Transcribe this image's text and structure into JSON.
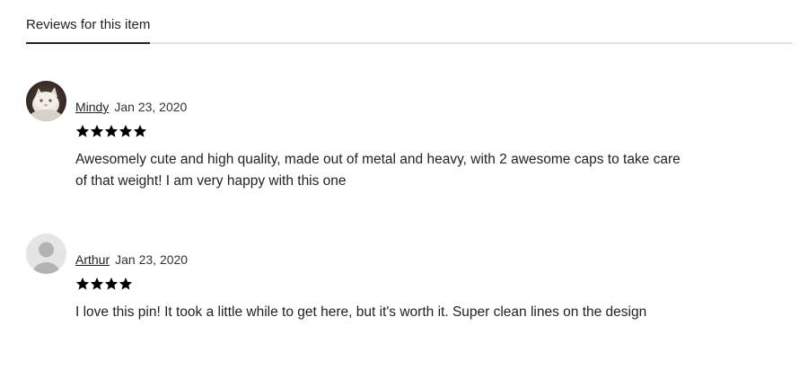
{
  "tabs": {
    "active_label": "Reviews for this item"
  },
  "reviews": [
    {
      "reviewer": "Mindy",
      "date": "Jan 23, 2020",
      "rating": 5,
      "text": "Awesomely cute and high quality, made out of metal and heavy, with 2 awesome caps to take care of that weight! I am very happy with this one",
      "avatar_icon": "cat-photo-avatar"
    },
    {
      "reviewer": "Arthur",
      "date": "Jan 23, 2020",
      "rating": 4,
      "text": "I love this pin! It took a little while to get here, but it's worth it. Super clean lines on the design",
      "avatar_icon": "default-user-avatar"
    }
  ],
  "colors": {
    "star": "#000000",
    "divider": "#e1e1e1",
    "text": "#222222"
  }
}
